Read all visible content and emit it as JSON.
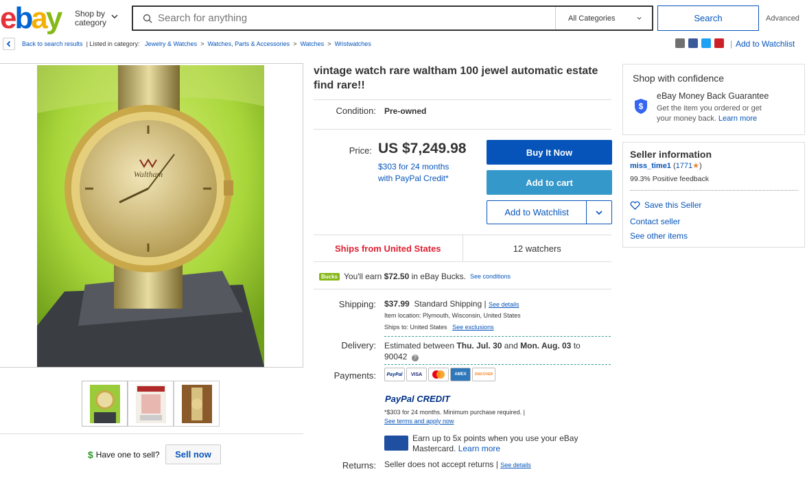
{
  "header": {
    "shop_by_line1": "Shop by",
    "shop_by_line2": "category",
    "search_placeholder": "Search for anything",
    "category": "All Categories",
    "search_button": "Search",
    "advanced": "Advanced"
  },
  "breadcrumb": {
    "back": "Back to search results",
    "listed_in": "| Listed in category:",
    "items": [
      "Jewelry & Watches",
      "Watches, Parts & Accessories",
      "Watches",
      "Wristwatches"
    ],
    "separator": ">",
    "add_to_watchlist": "Add to Watchlist"
  },
  "gallery": {
    "dial_brand": "Waltham",
    "have_one": "Have one to sell?",
    "sell_now": "Sell now"
  },
  "listing": {
    "title": "vintage watch rare waltham 100 jewel automatic estate find rare!!",
    "condition_label": "Condition:",
    "condition_value": "Pre-owned",
    "price_label": "Price:",
    "price": "US $7,249.98",
    "credit_line1": "$303 for 24 months",
    "credit_line2": "with PayPal Credit*",
    "buy_now": "Buy It Now",
    "add_to_cart": "Add to cart",
    "add_to_watchlist": "Add to Watchlist",
    "ships_from": "Ships from United States",
    "watchers": "12 watchers",
    "bucks_badge": "Bucks",
    "bucks_prefix": "You'll earn ",
    "bucks_amount": "$72.50",
    "bucks_suffix": " in eBay Bucks.",
    "see_conditions": "See conditions",
    "shipping_label": "Shipping:",
    "shipping_cost": "$37.99",
    "shipping_type": "Standard Shipping",
    "see_details": "See details",
    "item_location": "Item location:  Plymouth, Wisconsin, United States",
    "ships_to": "Ships to:  United States",
    "see_exclusions": "See exclusions",
    "delivery_label": "Delivery:",
    "delivery_prefix": "Estimated between ",
    "delivery_from": "Thu. Jul. 30",
    "delivery_and": " and ",
    "delivery_to": "Mon. Aug. 03",
    "delivery_suffix": " to",
    "delivery_zip": "90042",
    "payments_label": "Payments:",
    "payment_cards": [
      "PayPal",
      "VISA",
      "MC",
      "AMEX",
      "DISCOVER"
    ],
    "paypal_credit_logo": "PayPal CREDIT",
    "credit_note": "*$303 for 24 months. Minimum purchase required.  |",
    "see_terms": "See terms and apply now",
    "mastercard_line1": "Earn up to 5x points when you use your eBay",
    "mastercard_line2": "Mastercard.",
    "learn_more": "Learn more",
    "returns_label": "Returns:",
    "returns_value": "Seller does not accept returns",
    "returns_details": "See details"
  },
  "confidence": {
    "title": "Shop with confidence",
    "guarantee_title": "eBay Money Back Guarantee",
    "guarantee_line1": "Get the item you ordered or get",
    "guarantee_line2": "your money back.",
    "learn_more": "Learn more"
  },
  "seller": {
    "title": "Seller information",
    "name": "miss_time1",
    "feedback_count": "1771",
    "positive": "99.3% Positive feedback",
    "save": "Save this Seller",
    "contact": "Contact seller",
    "other_items": "See other items"
  },
  "colors": {
    "brand_blue": "#0654ba",
    "cart_blue": "#3498ca",
    "ships_red": "#dd1e31"
  }
}
